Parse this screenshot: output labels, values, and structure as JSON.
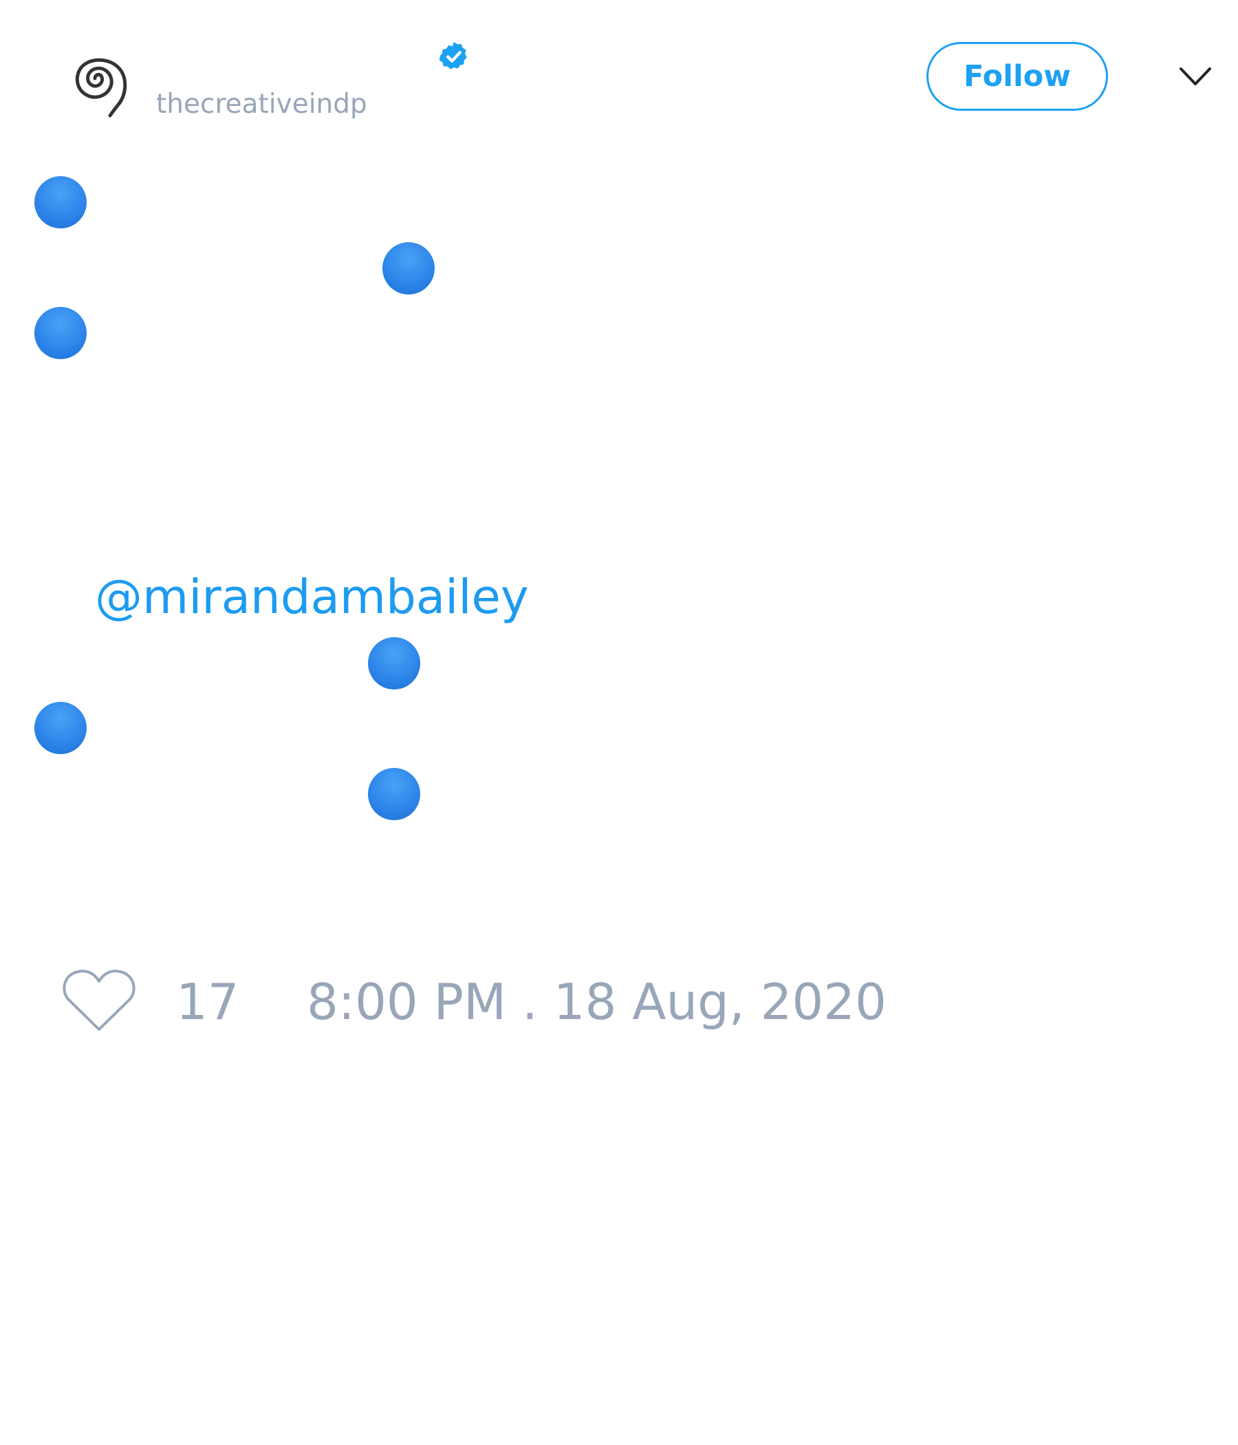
{
  "author": {
    "handle": "thecreativeindp",
    "avatar_icon": "spiral-avatar",
    "verified_icon": "verified-badge-icon"
  },
  "header": {
    "follow_label": "Follow",
    "menu_icon": "chevron-down-icon"
  },
  "tweet": {
    "mention": "@mirandambailey"
  },
  "footer": {
    "like_icon": "heart-icon",
    "like_count": "17",
    "timestamp": "8:00 PM . 18 Aug, 2020"
  },
  "colors": {
    "accent": "#1da1f2",
    "muted_text": "#98a6b8",
    "emoji_blue": "#2e86ea"
  }
}
